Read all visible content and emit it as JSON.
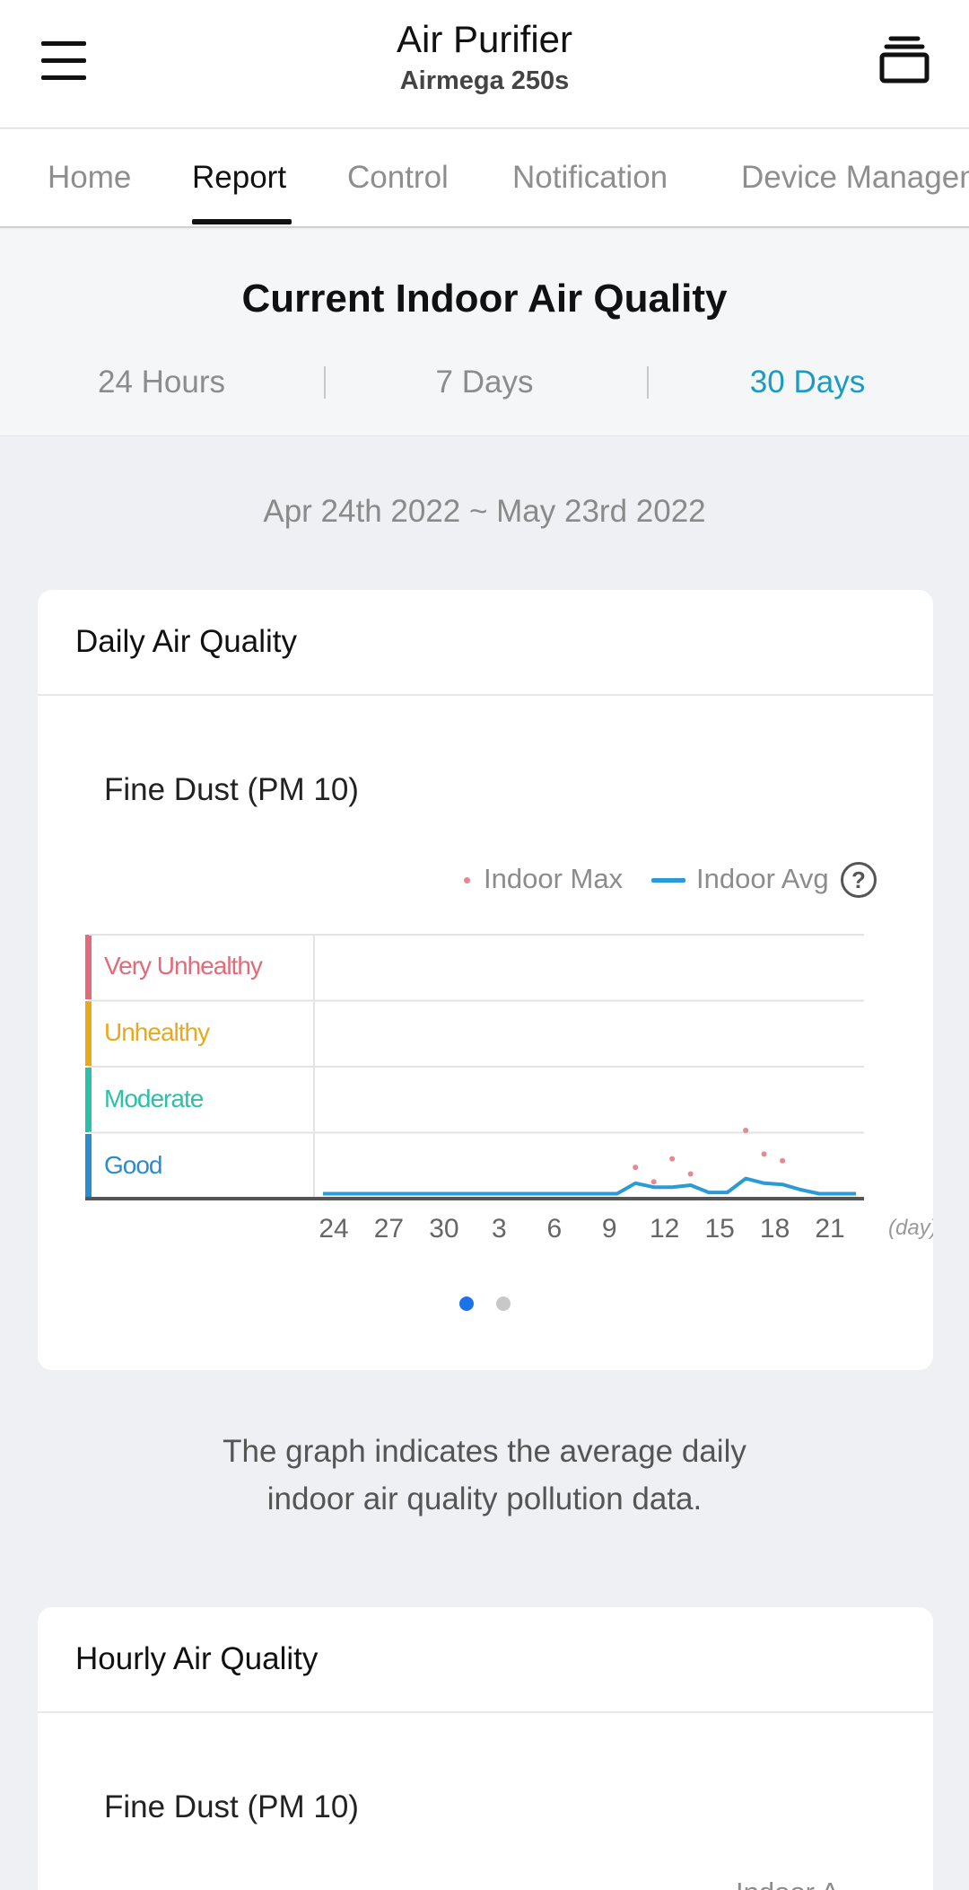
{
  "header": {
    "title": "Air Purifier",
    "subtitle": "Airmega 250s",
    "menu_icon": "hamburger-menu-icon",
    "stack_icon": "device-stack-icon"
  },
  "tabs": [
    {
      "label": "Home",
      "active": false
    },
    {
      "label": "Report",
      "active": true
    },
    {
      "label": "Control",
      "active": false
    },
    {
      "label": "Notification",
      "active": false
    },
    {
      "label": "Device Management",
      "active": false
    }
  ],
  "air_quality": {
    "title": "Current Indoor Air Quality",
    "periods": [
      {
        "label": "24 Hours",
        "active": false
      },
      {
        "label": "7 Days",
        "active": false
      },
      {
        "label": "30 Days",
        "active": true
      }
    ],
    "active_color": "#1a9bc4"
  },
  "date_range": "Apr 24th 2022 ~ May 23rd 2022",
  "daily_card": {
    "title": "Daily Air Quality",
    "chart_title": "Fine Dust (PM 10)",
    "legend": {
      "max_label": "Indoor Max",
      "avg_label": "Indoor Avg",
      "help": "?"
    },
    "bands": [
      {
        "label": "Very Unhealthy",
        "color": "#e06b7a"
      },
      {
        "label": "Unhealthy",
        "color": "#e8a91e"
      },
      {
        "label": "Moderate",
        "color": "#2ebfa8"
      },
      {
        "label": "Good",
        "color": "#2a8ccc"
      }
    ],
    "x_unit": "(day)",
    "pager": {
      "count": 2,
      "active": 0
    }
  },
  "chart_data": {
    "type": "line",
    "title": "Fine Dust (PM 10)",
    "xlabel": "(day)",
    "ylabel": "",
    "x_ticks": [
      "24",
      "27",
      "30",
      "3",
      "6",
      "9",
      "12",
      "15",
      "18",
      "21"
    ],
    "x": [
      24,
      25,
      26,
      27,
      28,
      29,
      30,
      1,
      2,
      3,
      4,
      5,
      6,
      7,
      8,
      9,
      10,
      11,
      12,
      13,
      14,
      15,
      16,
      17,
      18,
      19,
      20,
      21,
      22,
      23
    ],
    "ylim": [
      0,
      4
    ],
    "y_levels": [
      "Good",
      "Moderate",
      "Unhealthy",
      "Very Unhealthy"
    ],
    "series": [
      {
        "name": "Indoor Avg",
        "color": "#2a9bd6",
        "values": [
          0.02,
          0.02,
          0.02,
          0.02,
          0.02,
          0.02,
          0.02,
          0.02,
          0.02,
          0.02,
          0.02,
          0.02,
          0.02,
          0.02,
          0.02,
          0.02,
          0.02,
          0.18,
          0.12,
          0.12,
          0.15,
          0.04,
          0.04,
          0.25,
          0.18,
          0.16,
          0.08,
          0.02,
          0.02,
          0.02
        ]
      },
      {
        "name": "Indoor Max",
        "color": "#e8878f",
        "points": [
          [
            11,
            0.42
          ],
          [
            12,
            0.2
          ],
          [
            13,
            0.55
          ],
          [
            14,
            0.32
          ],
          [
            17,
            0.98
          ],
          [
            18,
            0.62
          ],
          [
            19,
            0.52
          ]
        ]
      }
    ],
    "legend": "top-right",
    "grid": true
  },
  "note": {
    "line1": "The graph indicates the average daily",
    "line2": "indoor air quality pollution data."
  },
  "hourly_card": {
    "title": "Hourly Air Quality",
    "chart_title": "Fine Dust (PM 10)",
    "legend_partial": "Indoor A"
  }
}
